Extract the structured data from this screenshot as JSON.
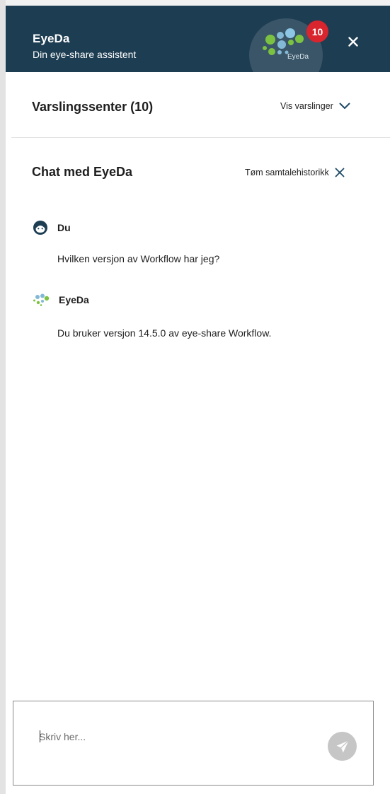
{
  "header": {
    "title": "EyeDa",
    "subtitle": "Din eye-share assistent",
    "logo_text": "EyeDa",
    "badge_count": "10",
    "close_icon": "close-icon",
    "colors": {
      "background": "#1d3d52",
      "badge": "#d9252d"
    }
  },
  "notifications": {
    "title": "Varslingssenter (10)",
    "action_label": "Vis varslinger",
    "action_icon": "chevron-down-icon"
  },
  "chat": {
    "title": "Chat med EyeDa",
    "clear_label": "Tøm samtalehistorikk",
    "clear_icon": "close-icon",
    "messages": [
      {
        "sender": "Du",
        "avatar": "user-face-icon",
        "text": "Hvilken versjon av Workflow har jeg?"
      },
      {
        "sender": "EyeDa",
        "avatar": "eyeda-logo-icon",
        "text": "Du bruker versjon 14.5.0 av eye-share Workflow."
      }
    ]
  },
  "input": {
    "placeholder": "Skriv her...",
    "value": "",
    "send_icon": "send-icon"
  }
}
